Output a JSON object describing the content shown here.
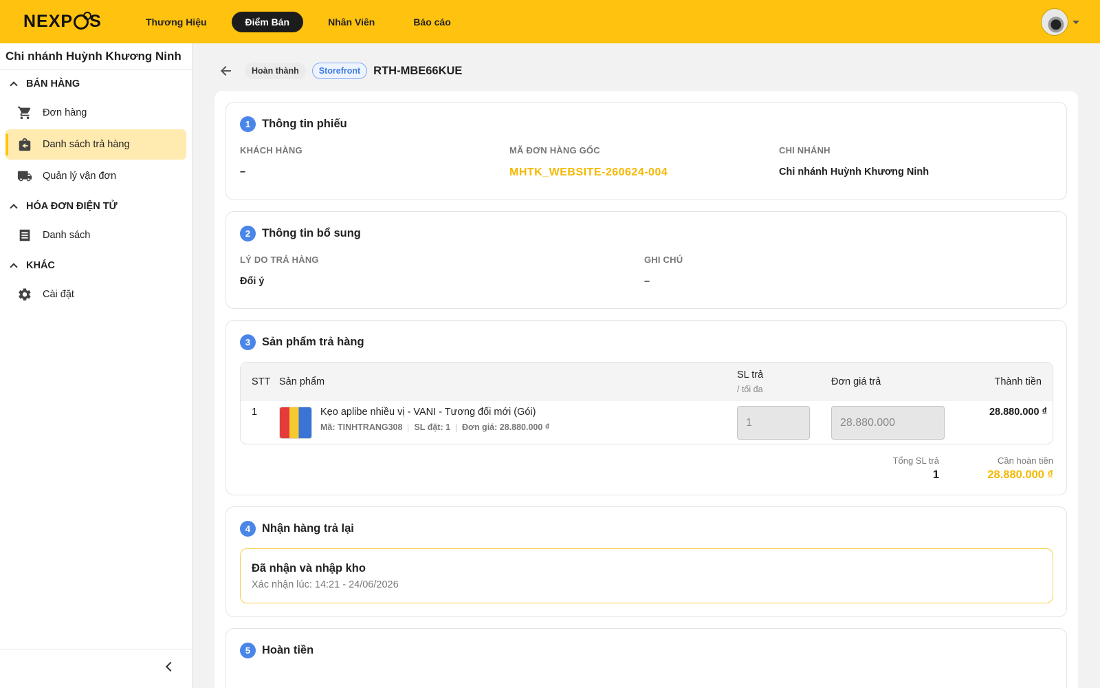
{
  "brand": {
    "logo": "NEXPOS",
    "accent": "#ffc20e"
  },
  "nav": {
    "items": [
      "Thương Hiệu",
      "Điểm Bán",
      "Nhân Viên",
      "Báo cáo"
    ],
    "active": "Điểm Bán"
  },
  "sidebar": {
    "branch": "Chi nhánh Huỳnh Khương Ninh",
    "groups": [
      {
        "label": "BÁN HÀNG",
        "items": [
          {
            "label": "Đơn hàng",
            "icon": "cart-icon"
          },
          {
            "label": "Danh sách trả hàng",
            "icon": "return-bag-icon",
            "active": true
          },
          {
            "label": "Quản lý vận đơn",
            "icon": "truck-icon"
          }
        ]
      },
      {
        "label": "HÓA ĐƠN ĐIỆN TỬ",
        "items": [
          {
            "label": "Danh sách",
            "icon": "list-icon"
          }
        ]
      },
      {
        "label": "KHÁC",
        "items": [
          {
            "label": "Cài đặt",
            "icon": "gear-icon"
          }
        ]
      }
    ]
  },
  "header": {
    "status": "Hoàn thành",
    "channel": "Storefront",
    "code": "RTH-MBE66KUE"
  },
  "section1": {
    "num": "1",
    "title": "Thông tin phiếu",
    "customer_label": "KHÁCH HÀNG",
    "customer_value": "–",
    "order_label": "MÃ ĐƠN HÀNG GỐC",
    "order_value": "MHTK_WEBSITE-260624-004",
    "branch_label": "CHI NHÁNH",
    "branch_value": "Chi nhánh Huỳnh Khương Ninh"
  },
  "section2": {
    "num": "2",
    "title": "Thông tin bổ sung",
    "reason_label": "LÝ DO TRẢ HÀNG",
    "reason_value": "Đổi ý",
    "note_label": "GHI CHÚ",
    "note_value": "–"
  },
  "section3": {
    "num": "3",
    "title": "Sản phẩm trả hàng",
    "columns": {
      "stt": "STT",
      "product": "Sản phẩm",
      "qty": "SL trả",
      "qty_sub": "/ tối đa",
      "price": "Đơn giá trả",
      "amount": "Thành tiền"
    },
    "row": {
      "stt": "1",
      "name": "Kẹo aplibe nhiều vị - VANI - Tương đối mới (Gói)",
      "sku": "Mã: TINHTRANG308",
      "ordered": "SL đặt: 1",
      "unit_price": "Đơn giá: 28.880.000 ₫",
      "qty_input": "1",
      "price_input": "28.880.000",
      "amount": "28.880.000 ₫"
    },
    "total_qty_label": "Tổng SL trả",
    "total_qty": "1",
    "refund_label": "Cần hoàn tiền",
    "refund": "28.880.000 ₫"
  },
  "section4": {
    "num": "4",
    "title": "Nhận hàng trả lại",
    "status": "Đã nhận và nhập kho",
    "confirmed": "Xác nhận lúc: 14:21 - 24/06/2026"
  },
  "section5": {
    "num": "5",
    "title": "Hoàn tiền"
  }
}
